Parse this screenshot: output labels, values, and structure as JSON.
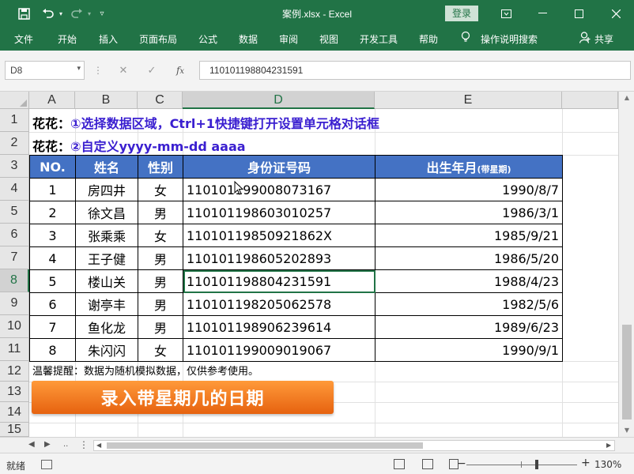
{
  "window": {
    "title": "案例.xlsx  -  Excel",
    "login_label": "登录",
    "icons": [
      "save-icon",
      "undo-icon",
      "redo-icon",
      "customize-qat-icon"
    ]
  },
  "ribbon": {
    "tabs": [
      "文件",
      "开始",
      "插入",
      "页面布局",
      "公式",
      "数据",
      "审阅",
      "视图",
      "开发工具",
      "帮助"
    ],
    "tell_me": "操作说明搜索",
    "share": "共享"
  },
  "formula_bar": {
    "name_box": "D8",
    "formula": "110101198804231591"
  },
  "columns": [
    "A",
    "B",
    "C",
    "D",
    "E"
  ],
  "rows": [
    "1",
    "2",
    "3",
    "4",
    "5",
    "6",
    "7",
    "8",
    "9",
    "10",
    "11",
    "12",
    "13",
    "14",
    "15"
  ],
  "notes": {
    "line1_label": "花花：",
    "line1_text": "①选择数据区域，Ctrl+1快捷键打开设置单元格对话框",
    "line2_label": "花花：",
    "line2_text": "②自定义yyyy-mm-dd aaaa"
  },
  "table": {
    "headers": {
      "no": "NO.",
      "name": "姓名",
      "gender": "性别",
      "id": "身份证号码",
      "birth": "出生年月",
      "birth_note": "(带星期)"
    },
    "rows": [
      {
        "no": "1",
        "name": "房四井",
        "gender": "女",
        "id": "110101199008073167",
        "birth": "1990/8/7"
      },
      {
        "no": "2",
        "name": "徐文昌",
        "gender": "男",
        "id": "110101198603010257",
        "birth": "1986/3/1"
      },
      {
        "no": "3",
        "name": "张乘乘",
        "gender": "女",
        "id": "11010119850921862X",
        "birth": "1985/9/21"
      },
      {
        "no": "4",
        "name": "王子健",
        "gender": "男",
        "id": "110101198605202893",
        "birth": "1986/5/20"
      },
      {
        "no": "5",
        "name": "楼山关",
        "gender": "男",
        "id": "110101198804231591",
        "birth": "1988/4/23"
      },
      {
        "no": "6",
        "name": "谢亭丰",
        "gender": "男",
        "id": "110101198205062578",
        "birth": "1982/5/6"
      },
      {
        "no": "7",
        "name": "鱼化龙",
        "gender": "男",
        "id": "110101198906239614",
        "birth": "1989/6/23"
      },
      {
        "no": "8",
        "name": "朱闪闪",
        "gender": "女",
        "id": "110101199009019067",
        "birth": "1990/9/1"
      }
    ]
  },
  "tip": "温馨提醒：数据为随机模拟数据，仅供参考使用。",
  "banner": "录入带星期几的日期",
  "status": {
    "ready": "就绪",
    "zoom": "130%"
  },
  "colors": {
    "excel_green": "#217346",
    "header_blue": "#4472c4",
    "note_purple": "#3a1fd0",
    "banner_orange": "#f07a22"
  }
}
